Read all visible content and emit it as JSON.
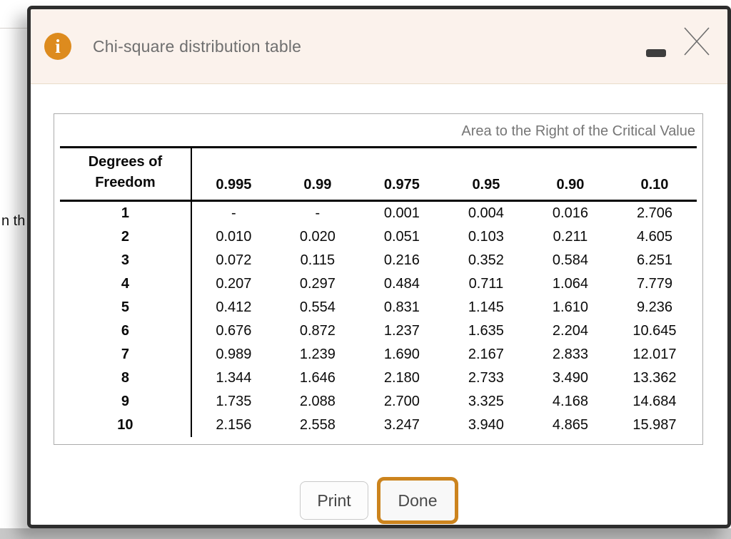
{
  "page_background": {
    "partial_text": "n th"
  },
  "dialog": {
    "header": {
      "title": "Chi-square distribution table",
      "info_icon_glyph": "i"
    },
    "table": {
      "caption": "Area to the Right of the Critical Value",
      "row_header": {
        "line1": "Degrees of",
        "line2": "Freedom"
      },
      "columns": [
        "0.995",
        "0.99",
        "0.975",
        "0.95",
        "0.90",
        "0.10"
      ],
      "rows": [
        {
          "df": "1",
          "values": [
            "-",
            "-",
            "0.001",
            "0.004",
            "0.016",
            "2.706"
          ]
        },
        {
          "df": "2",
          "values": [
            "0.010",
            "0.020",
            "0.051",
            "0.103",
            "0.211",
            "4.605"
          ]
        },
        {
          "df": "3",
          "values": [
            "0.072",
            "0.115",
            "0.216",
            "0.352",
            "0.584",
            "6.251"
          ]
        },
        {
          "df": "4",
          "values": [
            "0.207",
            "0.297",
            "0.484",
            "0.711",
            "1.064",
            "7.779"
          ]
        },
        {
          "df": "5",
          "values": [
            "0.412",
            "0.554",
            "0.831",
            "1.145",
            "1.610",
            "9.236"
          ]
        },
        {
          "df": "6",
          "values": [
            "0.676",
            "0.872",
            "1.237",
            "1.635",
            "2.204",
            "10.645"
          ]
        },
        {
          "df": "7",
          "values": [
            "0.989",
            "1.239",
            "1.690",
            "2.167",
            "2.833",
            "12.017"
          ]
        },
        {
          "df": "8",
          "values": [
            "1.344",
            "1.646",
            "2.180",
            "2.733",
            "3.490",
            "13.362"
          ]
        },
        {
          "df": "9",
          "values": [
            "1.735",
            "2.088",
            "2.700",
            "3.325",
            "4.168",
            "14.684"
          ]
        },
        {
          "df": "10",
          "values": [
            "2.156",
            "2.558",
            "3.247",
            "3.940",
            "4.865",
            "15.987"
          ]
        }
      ]
    },
    "buttons": {
      "print": "Print",
      "done": "Done"
    },
    "colors": {
      "accent_orange": "#dd8b1e",
      "done_border": "#cc841e",
      "header_background": "#fbf2ec",
      "dialog_border": "#2d2d2d"
    }
  }
}
